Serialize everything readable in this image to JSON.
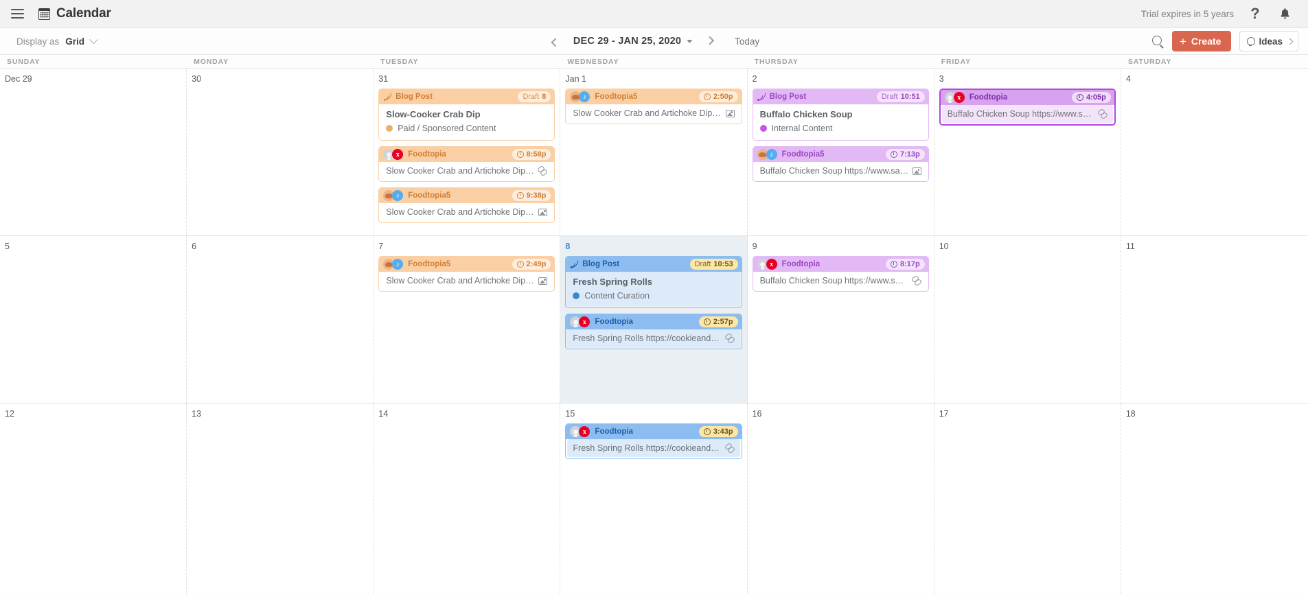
{
  "appbar": {
    "menu_icon": "hamburger-icon",
    "app_icon": "calendar-icon",
    "title": "Calendar",
    "trial_text": "Trial expires in 5 years",
    "help_icon": "question-mark-icon",
    "notifications_icon": "bell-icon"
  },
  "toolbar": {
    "display_label": "Display as",
    "display_value": "Grid",
    "prev_label": "previous-period",
    "date_range": "DEC 29 - JAN 25, 2020",
    "next_label": "next-period",
    "today_label": "Today",
    "search_icon": "search-icon",
    "create_label": "Create",
    "ideas_label": "Ideas"
  },
  "weekdays": [
    "SUNDAY",
    "MONDAY",
    "TUESDAY",
    "WEDNESDAY",
    "THURSDAY",
    "FRIDAY",
    "SATURDAY"
  ],
  "colors": {
    "accent": "#d9674f",
    "orange": "#fbcfa4",
    "purple": "#e2b8f5",
    "blue": "#8dbdf0",
    "selected_border": "#b249dc",
    "today_bg": "#e9eff2",
    "paid_sponsored_dot": "#e8b06a",
    "internal_content_dot": "#c455e8",
    "content_curation_dot": "#3f87c9"
  },
  "weeks": [
    {
      "days": [
        {
          "num": "Dec 29",
          "today": false,
          "events": []
        },
        {
          "num": "30",
          "today": false,
          "events": []
        },
        {
          "num": "31",
          "today": false,
          "events": [
            {
              "theme": "orange",
              "icon": "rss-icon",
              "title": "Blog Post",
              "badge_label": "Draft",
              "badge_value": "8",
              "badge_clock": false,
              "body_title": "Slow-Cooker Crab Dip",
              "meta": "Paid / Sponsored Content",
              "dot_color": "#e8b06a"
            },
            {
              "theme": "orange",
              "icon": "pinterest-avatars",
              "title": "Foodtopia",
              "badge_label": "",
              "badge_value": "8:58p",
              "badge_clock": true,
              "snippet": "Slow Cooker Crab and Artichoke Dip |...",
              "trail": "link-icon"
            },
            {
              "theme": "orange",
              "icon": "twitter-avatars",
              "title": "Foodtopia5",
              "badge_label": "",
              "badge_value": "9:38p",
              "badge_clock": true,
              "snippet": "Slow Cooker Crab and Artichoke Dip |...",
              "trail": "image-icon"
            }
          ]
        },
        {
          "num": "Jan 1",
          "today": false,
          "events": [
            {
              "theme": "orange",
              "icon": "twitter-avatars",
              "title": "Foodtopia5",
              "badge_label": "",
              "badge_value": "2:50p",
              "badge_clock": true,
              "snippet": "Slow Cooker Crab and Artichoke Dip |...",
              "trail": "image-icon"
            }
          ]
        },
        {
          "num": "2",
          "today": false,
          "events": [
            {
              "theme": "purple",
              "icon": "rss-icon",
              "title": "Blog Post",
              "badge_label": "Draft",
              "badge_value": "10:51",
              "badge_clock": false,
              "body_title": "Buffalo Chicken Soup",
              "meta": "Internal Content",
              "dot_color": "#c455e8"
            },
            {
              "theme": "purple",
              "icon": "twitter-avatars",
              "title": "Foodtopia5",
              "badge_label": "",
              "badge_value": "7:13p",
              "badge_clock": true,
              "snippet": "Buffalo Chicken Soup https://www.sal...",
              "trail": "image-icon"
            }
          ]
        },
        {
          "num": "3",
          "today": false,
          "events": [
            {
              "theme": "selected",
              "icon": "pinterest-avatars",
              "title": "Foodtopia",
              "badge_label": "",
              "badge_value": "4:05p",
              "badge_clock": true,
              "snippet": "Buffalo Chicken Soup https://www.sal...",
              "trail": "link-icon"
            }
          ]
        },
        {
          "num": "4",
          "today": false,
          "events": []
        }
      ]
    },
    {
      "days": [
        {
          "num": "5",
          "today": false,
          "events": []
        },
        {
          "num": "6",
          "today": false,
          "events": []
        },
        {
          "num": "7",
          "today": false,
          "events": [
            {
              "theme": "orange",
              "icon": "twitter-avatars",
              "title": "Foodtopia5",
              "badge_label": "",
              "badge_value": "2:49p",
              "badge_clock": true,
              "snippet": "Slow Cooker Crab and Artichoke Dip -...",
              "trail": "image-icon"
            }
          ]
        },
        {
          "num": "8",
          "today": true,
          "events": [
            {
              "theme": "blue",
              "icon": "rss-icon",
              "title": "Blog Post",
              "badge_label": "Draft",
              "badge_value": "10:53",
              "badge_clock": false,
              "body_title": "Fresh Spring Rolls",
              "meta": "Content Curation",
              "dot_color": "#3f87c9"
            },
            {
              "theme": "blue",
              "icon": "pinterest-avatars",
              "title": "Foodtopia",
              "badge_label": "",
              "badge_value": "2:57p",
              "badge_clock": true,
              "snippet": "Fresh Spring Rolls https://cookieandk...",
              "trail": "link-icon"
            }
          ]
        },
        {
          "num": "9",
          "today": false,
          "events": [
            {
              "theme": "purple",
              "icon": "pinterest-avatars",
              "title": "Foodtopia",
              "badge_label": "",
              "badge_value": "8:17p",
              "badge_clock": true,
              "snippet": "Buffalo Chicken Soup https://www.sal...",
              "trail": "link-icon"
            }
          ]
        },
        {
          "num": "10",
          "today": false,
          "events": []
        },
        {
          "num": "11",
          "today": false,
          "events": []
        }
      ]
    },
    {
      "days": [
        {
          "num": "12",
          "today": false,
          "events": []
        },
        {
          "num": "13",
          "today": false,
          "events": []
        },
        {
          "num": "14",
          "today": false,
          "events": []
        },
        {
          "num": "15",
          "today": false,
          "events": [
            {
              "theme": "blue",
              "icon": "pinterest-avatars",
              "title": "Foodtopia",
              "badge_label": "",
              "badge_value": "3:43p",
              "badge_clock": true,
              "snippet": "Fresh Spring Rolls https://cookieandk...",
              "trail": "link-icon"
            }
          ]
        },
        {
          "num": "16",
          "today": false,
          "events": []
        },
        {
          "num": "17",
          "today": false,
          "events": []
        },
        {
          "num": "18",
          "today": false,
          "events": []
        }
      ]
    }
  ]
}
